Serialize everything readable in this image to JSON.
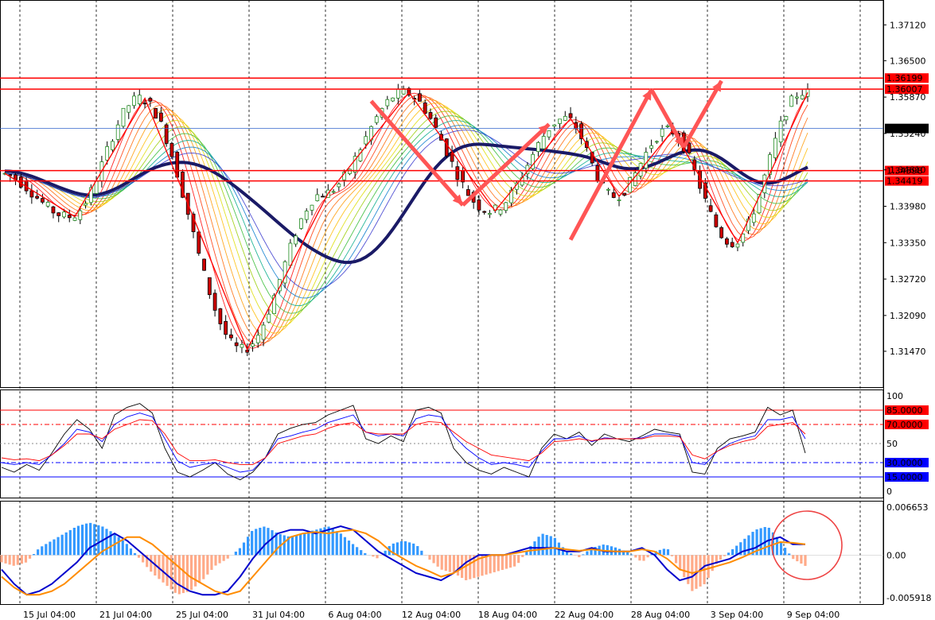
{
  "chart_data": [
    {
      "type": "candlestick",
      "instrument_pane": "price",
      "ylim": [
        1.3085,
        1.3755
      ],
      "y_ticks": [
        "1.37120",
        "1.36500",
        "1.35870",
        "1.35240",
        "1.34610",
        "1.33980",
        "1.33350",
        "1.32720",
        "1.32090",
        "1.31470"
      ],
      "current_price": "1.35326",
      "horizontal_levels": [
        {
          "label": "1.36199",
          "value": 1.36199
        },
        {
          "label": "1.36007",
          "value": 1.36007
        },
        {
          "label": "1.34598",
          "value": 1.34598
        },
        {
          "label": "1.34419",
          "value": 1.34419
        }
      ],
      "x_ticks": [
        "15 Jul 04:00",
        "21 Jul 04:00",
        "25 Jul 04:00",
        "31 Jul 04:00",
        "6 Aug 04:00",
        "12 Aug 04:00",
        "18 Aug 04:00",
        "22 Aug 04:00",
        "28 Aug 04:00",
        "3 Sep 04:00",
        "9 Sep 04:00"
      ],
      "zigzag_pivots": [
        1.3455,
        1.338,
        1.3585,
        1.315,
        1.342,
        1.3595,
        1.339,
        1.355,
        1.3415,
        1.353,
        1.3335,
        1.3595
      ],
      "forecast_arrows": [
        {
          "from": 1.358,
          "to": 1.34
        },
        {
          "from": 1.34,
          "to": 1.354
        },
        {
          "from": 1.334,
          "to": 1.36
        },
        {
          "from": 1.36,
          "to": 1.35
        },
        {
          "from": 1.35,
          "to": 1.3615
        }
      ]
    },
    {
      "type": "line",
      "instrument_pane": "stochastic",
      "ylim": [
        0,
        100
      ],
      "y_ticks": [
        "100",
        "50",
        "0"
      ],
      "levels": [
        {
          "label": "85.0000",
          "value": 85,
          "color": "#ff0000"
        },
        {
          "label": "70.0000",
          "value": 70,
          "color": "#ff0000"
        },
        {
          "label": "30.0000",
          "value": 30,
          "color": "#0000ff"
        },
        {
          "label": "15.0000",
          "value": 15,
          "color": "#0000ff"
        }
      ],
      "series": [
        {
          "color": "#000000",
          "values": [
            25,
            20,
            28,
            22,
            40,
            60,
            75,
            65,
            45,
            80,
            88,
            92,
            82,
            45,
            20,
            15,
            22,
            30,
            18,
            12,
            20,
            35,
            60,
            66,
            70,
            72,
            80,
            85,
            90,
            55,
            50,
            58,
            52,
            85,
            88,
            82,
            45,
            30,
            22,
            18,
            25,
            20,
            15,
            45,
            60,
            55,
            62,
            48,
            60,
            55,
            52,
            58,
            65,
            62,
            60,
            20,
            18,
            45,
            55,
            58,
            62,
            88,
            80,
            85,
            40
          ]
        },
        {
          "color": "#0000ff",
          "values": [
            30,
            28,
            30,
            28,
            38,
            50,
            65,
            62,
            52,
            70,
            78,
            82,
            78,
            55,
            32,
            25,
            28,
            30,
            25,
            20,
            22,
            35,
            55,
            58,
            62,
            65,
            72,
            76,
            80,
            62,
            58,
            60,
            58,
            76,
            80,
            78,
            58,
            45,
            35,
            28,
            30,
            28,
            25,
            42,
            55,
            55,
            58,
            52,
            56,
            55,
            55,
            56,
            60,
            60,
            58,
            30,
            28,
            42,
            50,
            55,
            58,
            75,
            75,
            78,
            55
          ]
        },
        {
          "color": "#ff0000",
          "values": [
            35,
            33,
            34,
            32,
            38,
            48,
            60,
            60,
            55,
            65,
            70,
            75,
            74,
            60,
            40,
            32,
            32,
            33,
            30,
            28,
            28,
            35,
            50,
            54,
            58,
            60,
            66,
            70,
            72,
            62,
            60,
            60,
            60,
            70,
            73,
            72,
            62,
            52,
            45,
            38,
            36,
            34,
            32,
            40,
            52,
            53,
            55,
            53,
            55,
            55,
            55,
            55,
            58,
            58,
            57,
            38,
            34,
            42,
            48,
            52,
            55,
            68,
            70,
            72,
            60
          ]
        }
      ]
    },
    {
      "type": "bar",
      "instrument_pane": "macd",
      "ylim": [
        -0.005918,
        0.006653
      ],
      "y_ticks": [
        "0.006653",
        "0.00",
        "-0.005918"
      ],
      "histogram": [
        -0.001,
        -0.0015,
        -0.001,
        0.001,
        0.002,
        0.003,
        0.004,
        0.0045,
        0.004,
        0.003,
        0.0015,
        -0.0005,
        -0.0025,
        -0.004,
        -0.0055,
        -0.005,
        -0.0035,
        -0.0015,
        -0.0005,
        0.001,
        0.0035,
        0.004,
        0.003,
        0.0025,
        0.003,
        0.0035,
        0.004,
        0.003,
        0.0015,
        0.0002,
        -0.0005,
        0.0015,
        0.002,
        0.0015,
        -0.0005,
        -0.002,
        -0.0025,
        -0.0035,
        -0.003,
        -0.0025,
        -0.002,
        -0.0015,
        0.001,
        0.003,
        0.0025,
        0.0005,
        -0.0003,
        0.001,
        0.0015,
        0.001,
        0.0003,
        -0.001,
        0.0005,
        0.001,
        -0.002,
        -0.005,
        -0.004,
        -0.001,
        0.0005,
        0.002,
        0.0035,
        0.004,
        0.002,
        -0.0005,
        -0.0015
      ],
      "series": [
        {
          "color": "#0000cc",
          "values": [
            -0.002,
            -0.004,
            -0.0055,
            -0.005,
            -0.004,
            -0.0025,
            -0.001,
            0.001,
            0.002,
            0.003,
            0.002,
            0.0005,
            -0.001,
            -0.0025,
            -0.004,
            -0.005,
            -0.0055,
            -0.0055,
            -0.005,
            -0.003,
            -0.0005,
            0.0015,
            0.003,
            0.0035,
            0.0035,
            0.003,
            0.0035,
            0.004,
            0.0035,
            0.002,
            0.0005,
            -0.0005,
            -0.0015,
            -0.0025,
            -0.003,
            -0.0035,
            -0.0025,
            -0.001,
            0,
            0,
            0,
            0.0005,
            0.001,
            0.001,
            0.001,
            0.0005,
            0.0005,
            0.001,
            0.0005,
            0.0005,
            0.0005,
            0.001,
            0,
            -0.002,
            -0.0035,
            -0.003,
            -0.0015,
            -0.001,
            -0.0005,
            0.0005,
            0.001,
            0.002,
            0.0025,
            0.0015,
            0.0015
          ]
        },
        {
          "color": "#ff8c00",
          "values": [
            -0.003,
            -0.0045,
            -0.0055,
            -0.0055,
            -0.005,
            -0.004,
            -0.0025,
            -0.001,
            0.0005,
            0.0015,
            0.0025,
            0.0025,
            0.0015,
            0,
            -0.0015,
            -0.003,
            -0.004,
            -0.005,
            -0.0055,
            -0.005,
            -0.003,
            -0.001,
            0.001,
            0.0025,
            0.003,
            0.0032,
            0.003,
            0.0033,
            0.0035,
            0.003,
            0.002,
            0.0005,
            -0.0005,
            -0.0015,
            -0.0022,
            -0.003,
            -0.0025,
            -0.0015,
            -0.0005,
            0,
            0,
            0.0003,
            0.0006,
            0.0008,
            0.001,
            0.0008,
            0.0006,
            0.0008,
            0.0006,
            0.0005,
            0.0005,
            0.0008,
            0.0005,
            -0.0005,
            -0.002,
            -0.0025,
            -0.002,
            -0.0015,
            -0.001,
            -0.0003,
            0.0005,
            0.0012,
            0.0018,
            0.0017,
            0.0015
          ]
        }
      ]
    }
  ]
}
